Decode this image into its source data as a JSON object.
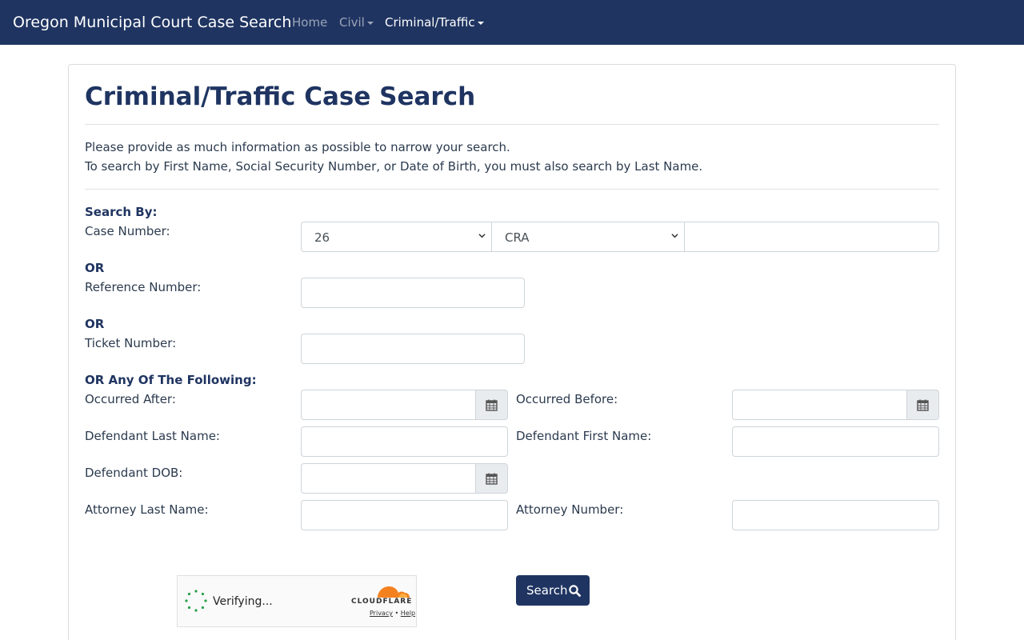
{
  "navbar": {
    "brand": "Oregon Municipal Court Case Search",
    "items": [
      {
        "label": "Home"
      },
      {
        "label": "Civil"
      },
      {
        "label": "Criminal/Traffic"
      }
    ]
  },
  "page": {
    "title": "Criminal/Traffic Case Search",
    "intro_line1": "Please provide as much information as possible to narrow your search.",
    "intro_line2": "To search by First Name, Social Security Number, or Date of Birth, you must also search by Last Name."
  },
  "form": {
    "search_by": "Search By:",
    "case_number_label": "Case Number:",
    "case_year_value": "26",
    "case_type_value": "CRA",
    "case_seq_value": "",
    "or1": "OR",
    "reference_number_label": "Reference Number:",
    "reference_number_value": "",
    "or2": "OR",
    "ticket_number_label": "Ticket Number:",
    "ticket_number_value": "",
    "or_any": "OR Any Of The Following:",
    "occurred_after_label": "Occurred After:",
    "occurred_before_label": "Occurred Before:",
    "def_last_label": "Defendant Last Name:",
    "def_first_label": "Defendant First Name:",
    "def_dob_label": "Defendant DOB:",
    "att_last_label": "Attorney Last Name:",
    "att_number_label": "Attorney Number:",
    "search_button": "Search"
  },
  "captcha": {
    "status": "Verifying...",
    "brand": "CLOUDFLARE",
    "privacy": "Privacy",
    "separator": "•",
    "help": "Help"
  },
  "colors": {
    "navbar": "#1f3461",
    "primary": "#1f3461",
    "cloudflare_orange": "#f48120"
  }
}
